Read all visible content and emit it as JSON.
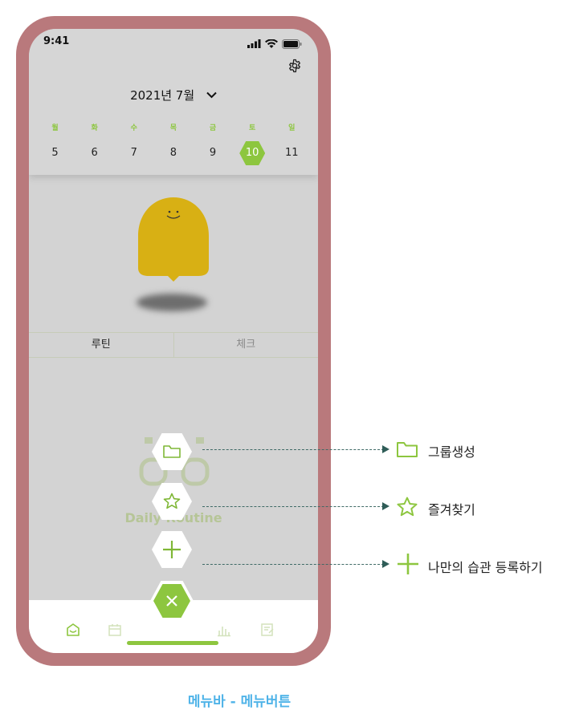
{
  "status_bar": {
    "time": "9:41"
  },
  "calendar": {
    "month_label": "2021년 7월",
    "weekdays": [
      "월",
      "화",
      "수",
      "목",
      "금",
      "토",
      "일"
    ],
    "dates": [
      "5",
      "6",
      "7",
      "8",
      "9",
      "10",
      "11"
    ],
    "selected_date": "10"
  },
  "tabs": {
    "routine": "루틴",
    "check": "체크"
  },
  "watermark": {
    "text": "Daily Routine"
  },
  "menu": {
    "items": [
      {
        "icon": "folder-icon",
        "label": "그룹생성"
      },
      {
        "icon": "star-icon",
        "label": "즐겨찾기"
      },
      {
        "icon": "plus-icon",
        "label": "나만의 습관 등록하기"
      }
    ],
    "close_icon": "close-icon"
  },
  "bottom_nav": {
    "icons": [
      "home-icon",
      "calendar-icon",
      "bar-chart-icon",
      "note-icon"
    ]
  },
  "caption": "메뉴바 - 메뉴버튼",
  "colors": {
    "accent": "#8dc63f",
    "frame": "#b9797c",
    "screen": "#d3d3d3",
    "character": "#d8b014",
    "caption": "#4fb3e8",
    "annotation_line": "#3f6a66"
  }
}
